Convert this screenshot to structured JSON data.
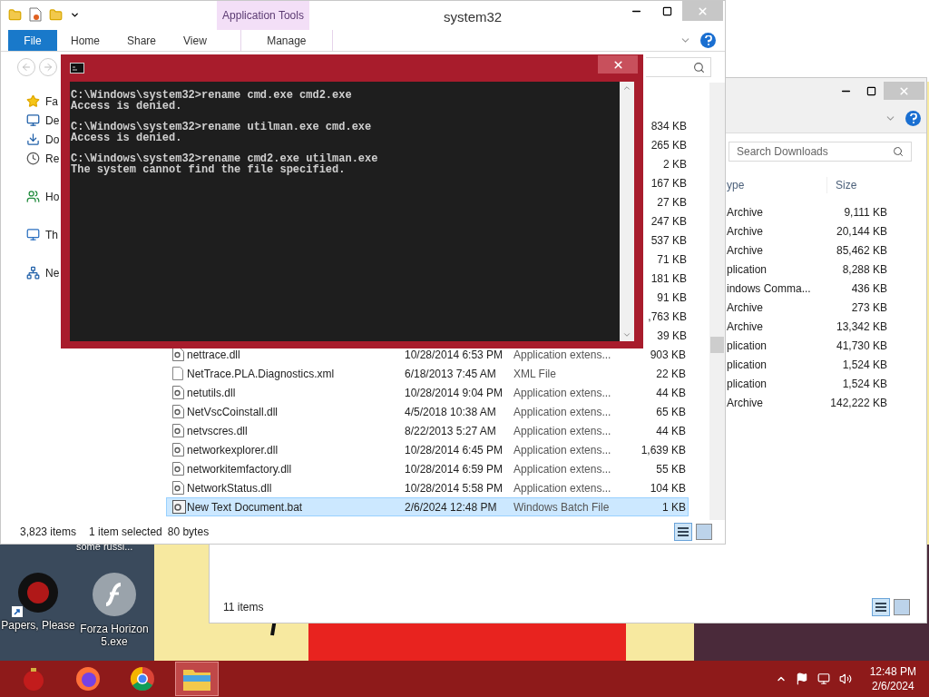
{
  "explorer": {
    "title": "system32",
    "context_tab": "Application Tools",
    "ribbon_tabs": [
      {
        "label": "File",
        "kind": "file"
      },
      {
        "label": "Home",
        "kind": "tab"
      },
      {
        "label": "Share",
        "kind": "tab"
      },
      {
        "label": "View",
        "kind": "tab"
      },
      {
        "label": "Manage",
        "kind": "context"
      }
    ],
    "nav_groups": [
      [
        {
          "label": "Fa",
          "kind": "star"
        },
        {
          "label": "De",
          "kind": "desktop"
        },
        {
          "label": "Do",
          "kind": "downloads"
        },
        {
          "label": "Re",
          "kind": "recent"
        }
      ],
      [
        {
          "label": "Ho",
          "kind": "homegroup"
        }
      ],
      [
        {
          "label": "Th",
          "kind": "pc"
        }
      ],
      [
        {
          "label": "Ne",
          "kind": "network"
        }
      ]
    ],
    "partial_sizes": [
      "834 KB",
      "265 KB",
      "2 KB",
      "167 KB",
      "27 KB",
      "247 KB",
      "537 KB",
      "71 KB",
      "181 KB",
      "91 KB",
      ",763 KB",
      "39 KB"
    ],
    "rows": [
      {
        "name": "nettrace.dll",
        "date": "10/28/2014 6:53 PM",
        "type": "Application extens...",
        "size": "903 KB",
        "kind": "dll",
        "selected": false
      },
      {
        "name": "NetTrace.PLA.Diagnostics.xml",
        "date": "6/18/2013 7:45 AM",
        "type": "XML File",
        "size": "22 KB",
        "kind": "xml",
        "selected": false
      },
      {
        "name": "netutils.dll",
        "date": "10/28/2014 9:04 PM",
        "type": "Application extens...",
        "size": "44 KB",
        "kind": "dll",
        "selected": false
      },
      {
        "name": "NetVscCoinstall.dll",
        "date": "4/5/2018 10:38 AM",
        "type": "Application extens...",
        "size": "65 KB",
        "kind": "dll",
        "selected": false
      },
      {
        "name": "netvscres.dll",
        "date": "8/22/2013 5:27 AM",
        "type": "Application extens...",
        "size": "44 KB",
        "kind": "dll",
        "selected": false
      },
      {
        "name": "networkexplorer.dll",
        "date": "10/28/2014 6:45 PM",
        "type": "Application extens...",
        "size": "1,639 KB",
        "kind": "dll",
        "selected": false
      },
      {
        "name": "networkitemfactory.dll",
        "date": "10/28/2014 6:59 PM",
        "type": "Application extens...",
        "size": "55 KB",
        "kind": "dll",
        "selected": false
      },
      {
        "name": "NetworkStatus.dll",
        "date": "10/28/2014 5:58 PM",
        "type": "Application extens...",
        "size": "104 KB",
        "kind": "dll",
        "selected": false
      },
      {
        "name": "New Text Document.bat",
        "date": "2/6/2024 12:48 PM",
        "type": "Windows Batch File",
        "size": "1 KB",
        "kind": "bat",
        "selected": true
      }
    ],
    "status": {
      "count": "3,823 items",
      "selected": "1 item selected",
      "size": "80 bytes"
    }
  },
  "console": {
    "entries": [
      {
        "command": "C:\\Windows\\system32>rename cmd.exe cmd2.exe",
        "output": "Access is denied."
      },
      {
        "command": "C:\\Windows\\system32>rename utilman.exe cmd.exe",
        "output": "Access is denied."
      },
      {
        "command": "C:\\Windows\\system32>rename cmd2.exe utilman.exe",
        "output": "The system cannot find the file specified."
      }
    ]
  },
  "downloads_window": {
    "search_placeholder": "Search Downloads",
    "columns": [
      "ype",
      "Size"
    ],
    "rows": [
      {
        "type": "Archive",
        "size": "9,111 KB"
      },
      {
        "type": "Archive",
        "size": "20,144 KB"
      },
      {
        "type": "Archive",
        "size": "85,462 KB"
      },
      {
        "type": "plication",
        "size": "8,288 KB"
      },
      {
        "type": "indows Comma...",
        "size": "436 KB"
      },
      {
        "type": "Archive",
        "size": "273 KB"
      },
      {
        "type": "Archive",
        "size": "13,342 KB"
      },
      {
        "type": "plication",
        "size": "41,730 KB"
      },
      {
        "type": "plication",
        "size": "1,524 KB"
      },
      {
        "type": "plication",
        "size": "1,524 KB"
      },
      {
        "type": "Archive",
        "size": "142,222 KB"
      }
    ],
    "status": "11 items"
  },
  "desktop": {
    "cut_label": "some russi...",
    "icons": [
      {
        "kind": "game",
        "label": "Papers, Please"
      },
      {
        "kind": "flash",
        "label": "Forza Horizon 5.exe"
      }
    ]
  },
  "taskbar": {
    "apps": [
      {
        "kind": "ornament",
        "active": false
      },
      {
        "kind": "firefox",
        "active": false
      },
      {
        "kind": "chrome",
        "active": false
      },
      {
        "kind": "explorer",
        "active": true
      }
    ],
    "time": "12:48 PM",
    "date": "2/6/2024"
  }
}
